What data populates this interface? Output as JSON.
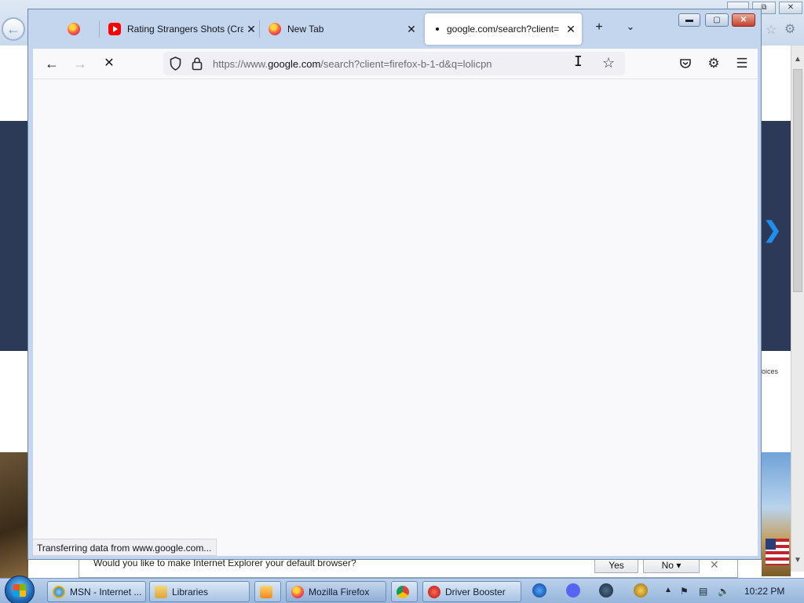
{
  "background_window": {
    "choices_fragment": "oices",
    "notification": {
      "message": "Would you like to make Internet Explorer your default browser?",
      "yes_label": "Yes",
      "no_label": "No"
    }
  },
  "firefox": {
    "tabs": [
      {
        "title": "",
        "icon": "firefox-icon"
      },
      {
        "title": "Rating Strangers Shots (Cra",
        "icon": "youtube-icon"
      },
      {
        "title": "New Tab",
        "icon": "firefox-icon"
      },
      {
        "title": "google.com/search?client=",
        "icon": "loading-dot",
        "active": true
      }
    ],
    "url": {
      "prefix": "https://www.",
      "host": "google.com",
      "path": "/search?client=firefox-b-1-d&q=lolicpn"
    },
    "status_text": "Transferring data from www.google.com..."
  },
  "taskbar": {
    "items": [
      {
        "label": "MSN - Internet ...",
        "icon": "internet-explorer-icon"
      },
      {
        "label": "Libraries",
        "icon": "folder-icon"
      },
      {
        "label": "",
        "icon": "media-player-icon"
      },
      {
        "label": "Mozilla Firefox",
        "icon": "firefox-icon",
        "active": true
      },
      {
        "label": "",
        "icon": "chrome-icon"
      },
      {
        "label": "Driver Booster",
        "icon": "driver-booster-icon"
      }
    ],
    "clock": "10:22 PM"
  },
  "colors": {
    "firefox_frame": "#c3d6ee",
    "content_bg": "#f9f9fb",
    "bg_navy": "#2c3a58",
    "close_red": "#c6412a"
  }
}
